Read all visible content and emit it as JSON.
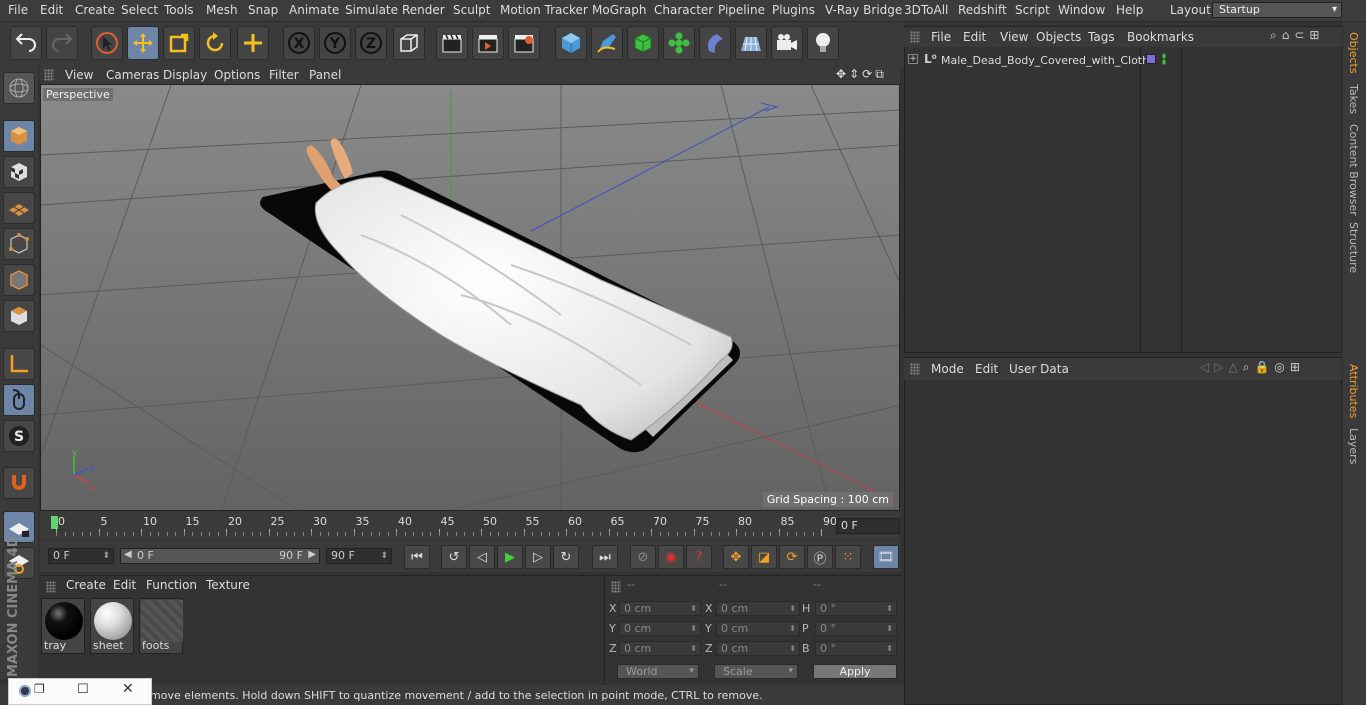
{
  "menu": [
    "File",
    "Edit",
    "Create",
    "Select",
    "Tools",
    "Mesh",
    "Snap",
    "Animate",
    "Simulate",
    "Render",
    "Sculpt",
    "Motion Tracker",
    "MoGraph",
    "Character",
    "Pipeline",
    "Plugins",
    "V-Ray Bridge",
    "3DToAll",
    "Redshift",
    "Script",
    "Window",
    "Help"
  ],
  "layout": {
    "label": "Layout:",
    "value": "Startup"
  },
  "viewport": {
    "menu": [
      "View",
      "Cameras",
      "Display",
      "Options",
      "Filter",
      "Panel"
    ],
    "camera_label": "Perspective",
    "grid_spacing": "Grid Spacing : 100 cm"
  },
  "timeline": {
    "ticks": [
      "0",
      "5",
      "10",
      "15",
      "20",
      "25",
      "30",
      "35",
      "40",
      "45",
      "50",
      "55",
      "60",
      "65",
      "70",
      "75",
      "80",
      "85",
      "90"
    ],
    "current_frame": "0 F",
    "start_field": "0 F",
    "range_start": "0 F",
    "range_end": "90 F",
    "end_field": "90 F"
  },
  "materials": {
    "menu": [
      "Create",
      "Edit",
      "Function",
      "Texture"
    ],
    "items": [
      {
        "name": "tray",
        "color": "#000000"
      },
      {
        "name": "sheet",
        "color": "#e8e8e8"
      },
      {
        "name": "foots",
        "color": "#555555"
      }
    ]
  },
  "coords": {
    "headers": [
      "--",
      "--",
      "--"
    ],
    "rows": [
      {
        "l1": "X",
        "v1": "0 cm",
        "l2": "X",
        "v2": "0 cm",
        "l3": "H",
        "v3": "0 °"
      },
      {
        "l1": "Y",
        "v1": "0 cm",
        "l2": "Y",
        "v2": "0 cm",
        "l3": "P",
        "v3": "0 °"
      },
      {
        "l1": "Z",
        "v1": "0 cm",
        "l2": "Z",
        "v2": "0 cm",
        "l3": "B",
        "v3": "0 °"
      }
    ],
    "world": "World",
    "scale": "Scale",
    "apply": "Apply"
  },
  "status": "move elements. Hold down SHIFT to quantize movement / add to the selection in point mode, CTRL to remove.",
  "objects": {
    "menu": [
      "File",
      "Edit",
      "View",
      "Objects",
      "Tags",
      "Bookmarks"
    ],
    "items": [
      {
        "name": "Male_Dead_Body_Covered_with_Cloth"
      }
    ]
  },
  "attributes": {
    "menu": [
      "Mode",
      "Edit",
      "User Data"
    ]
  },
  "right_tabs": [
    "Objects",
    "Takes",
    "Content Browser",
    "Structure",
    "Attributes",
    "Layers"
  ],
  "brand": "MAXON CINEMA 4D"
}
